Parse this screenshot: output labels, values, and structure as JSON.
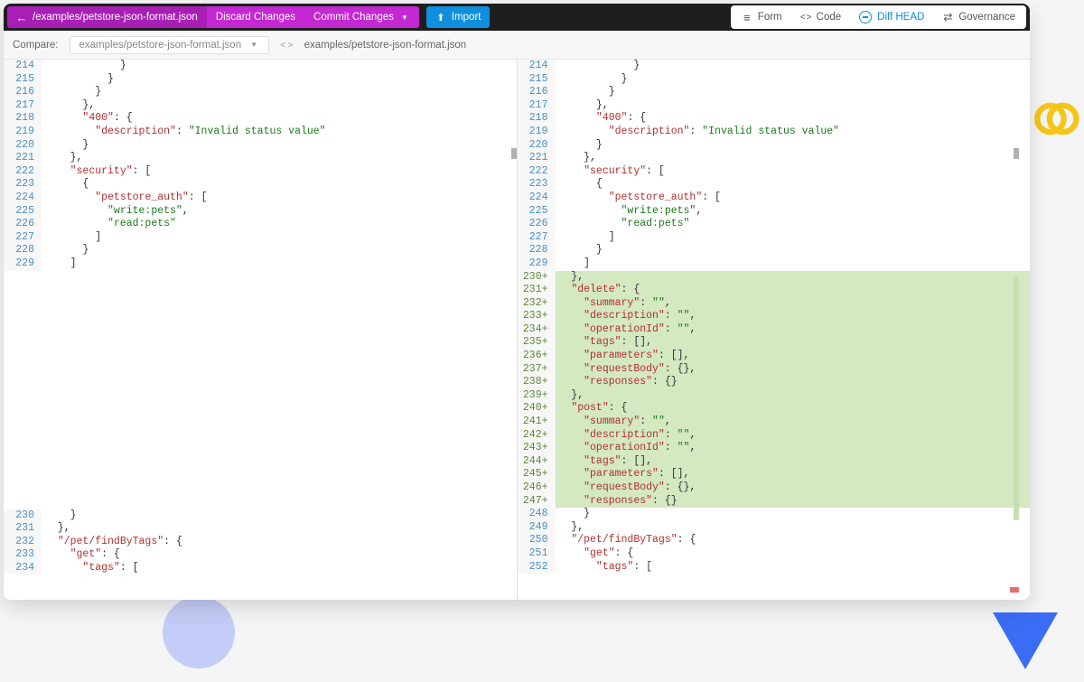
{
  "toolbar": {
    "path": "/examples/petstore-json-format.json",
    "discard": "Discard Changes",
    "commit": "Commit Changes",
    "import": "Import"
  },
  "views": {
    "form": "Form",
    "code": "Code",
    "diff": "Diff HEAD",
    "governance": "Governance"
  },
  "compare": {
    "label": "Compare:",
    "left_file": "examples/petstore-json-format.json",
    "right_file": "examples/petstore-json-format.json"
  },
  "left_lines": [
    {
      "n": "214",
      "code": [
        [
          "p",
          "            }"
        ]
      ]
    },
    {
      "n": "215",
      "code": [
        [
          "p",
          "          }"
        ]
      ]
    },
    {
      "n": "216",
      "code": [
        [
          "p",
          "        }"
        ]
      ]
    },
    {
      "n": "217",
      "code": [
        [
          "p",
          "      },"
        ]
      ]
    },
    {
      "n": "218",
      "code": [
        [
          "p",
          "      "
        ],
        [
          "k",
          "\"400\""
        ],
        [
          "p",
          ": {"
        ]
      ]
    },
    {
      "n": "219",
      "code": [
        [
          "p",
          "        "
        ],
        [
          "k",
          "\"description\""
        ],
        [
          "p",
          ": "
        ],
        [
          "s",
          "\"Invalid status value\""
        ]
      ]
    },
    {
      "n": "220",
      "code": [
        [
          "p",
          "      }"
        ]
      ]
    },
    {
      "n": "221",
      "code": [
        [
          "p",
          "    },"
        ]
      ]
    },
    {
      "n": "222",
      "code": [
        [
          "p",
          "    "
        ],
        [
          "k",
          "\"security\""
        ],
        [
          "p",
          ": ["
        ]
      ]
    },
    {
      "n": "223",
      "code": [
        [
          "p",
          "      {"
        ]
      ]
    },
    {
      "n": "224",
      "code": [
        [
          "p",
          "        "
        ],
        [
          "k",
          "\"petstore_auth\""
        ],
        [
          "p",
          ": ["
        ]
      ]
    },
    {
      "n": "225",
      "code": [
        [
          "p",
          "          "
        ],
        [
          "s",
          "\"write:pets\""
        ],
        [
          "p",
          ","
        ]
      ]
    },
    {
      "n": "226",
      "code": [
        [
          "p",
          "          "
        ],
        [
          "s",
          "\"read:pets\""
        ]
      ]
    },
    {
      "n": "227",
      "code": [
        [
          "p",
          "        ]"
        ]
      ]
    },
    {
      "n": "228",
      "code": [
        [
          "p",
          "      }"
        ]
      ]
    },
    {
      "n": "229",
      "code": [
        [
          "p",
          "    ]"
        ]
      ]
    }
  ],
  "left_bottom": [
    {
      "n": "230",
      "code": [
        [
          "p",
          "    }"
        ]
      ]
    },
    {
      "n": "231",
      "code": [
        [
          "p",
          "  },"
        ]
      ]
    },
    {
      "n": "232",
      "code": [
        [
          "p",
          "  "
        ],
        [
          "k",
          "\"/pet/findByTags\""
        ],
        [
          "p",
          ": {"
        ]
      ]
    },
    {
      "n": "233",
      "code": [
        [
          "p",
          "    "
        ],
        [
          "k",
          "\"get\""
        ],
        [
          "p",
          ": {"
        ]
      ]
    },
    {
      "n": "234",
      "code": [
        [
          "p",
          "      "
        ],
        [
          "k",
          "\"tags\""
        ],
        [
          "p",
          ": ["
        ]
      ]
    }
  ],
  "right_lines": [
    {
      "n": "214",
      "code": [
        [
          "p",
          "            }"
        ]
      ]
    },
    {
      "n": "215",
      "code": [
        [
          "p",
          "          }"
        ]
      ]
    },
    {
      "n": "216",
      "code": [
        [
          "p",
          "        }"
        ]
      ]
    },
    {
      "n": "217",
      "code": [
        [
          "p",
          "      },"
        ]
      ]
    },
    {
      "n": "218",
      "code": [
        [
          "p",
          "      "
        ],
        [
          "k",
          "\"400\""
        ],
        [
          "p",
          ": {"
        ]
      ]
    },
    {
      "n": "219",
      "code": [
        [
          "p",
          "        "
        ],
        [
          "k",
          "\"description\""
        ],
        [
          "p",
          ": "
        ],
        [
          "s",
          "\"Invalid status value\""
        ]
      ]
    },
    {
      "n": "220",
      "code": [
        [
          "p",
          "      }"
        ]
      ]
    },
    {
      "n": "221",
      "code": [
        [
          "p",
          "    },"
        ]
      ]
    },
    {
      "n": "222",
      "code": [
        [
          "p",
          "    "
        ],
        [
          "k",
          "\"security\""
        ],
        [
          "p",
          ": ["
        ]
      ]
    },
    {
      "n": "223",
      "code": [
        [
          "p",
          "      {"
        ]
      ]
    },
    {
      "n": "224",
      "code": [
        [
          "p",
          "        "
        ],
        [
          "k",
          "\"petstore_auth\""
        ],
        [
          "p",
          ": ["
        ]
      ]
    },
    {
      "n": "225",
      "code": [
        [
          "p",
          "          "
        ],
        [
          "s",
          "\"write:pets\""
        ],
        [
          "p",
          ","
        ]
      ]
    },
    {
      "n": "226",
      "code": [
        [
          "p",
          "          "
        ],
        [
          "s",
          "\"read:pets\""
        ]
      ]
    },
    {
      "n": "227",
      "code": [
        [
          "p",
          "        ]"
        ]
      ]
    },
    {
      "n": "228",
      "code": [
        [
          "p",
          "      }"
        ]
      ]
    },
    {
      "n": "229",
      "code": [
        [
          "p",
          "    ]"
        ]
      ]
    }
  ],
  "right_added": [
    {
      "n": "230+",
      "code": [
        [
          "p",
          "  },"
        ]
      ]
    },
    {
      "n": "231+",
      "code": [
        [
          "p",
          "  "
        ],
        [
          "k",
          "\"delete\""
        ],
        [
          "p",
          ": {"
        ]
      ]
    },
    {
      "n": "232+",
      "code": [
        [
          "p",
          "    "
        ],
        [
          "k",
          "\"summary\""
        ],
        [
          "p",
          ": "
        ],
        [
          "s",
          "\"\""
        ],
        [
          "p",
          ","
        ]
      ]
    },
    {
      "n": "233+",
      "code": [
        [
          "p",
          "    "
        ],
        [
          "k",
          "\"description\""
        ],
        [
          "p",
          ": "
        ],
        [
          "s",
          "\"\""
        ],
        [
          "p",
          ","
        ]
      ]
    },
    {
      "n": "234+",
      "code": [
        [
          "p",
          "    "
        ],
        [
          "k",
          "\"operationId\""
        ],
        [
          "p",
          ": "
        ],
        [
          "s",
          "\"\""
        ],
        [
          "p",
          ","
        ]
      ]
    },
    {
      "n": "235+",
      "code": [
        [
          "p",
          "    "
        ],
        [
          "k",
          "\"tags\""
        ],
        [
          "p",
          ": [],"
        ]
      ]
    },
    {
      "n": "236+",
      "code": [
        [
          "p",
          "    "
        ],
        [
          "k",
          "\"parameters\""
        ],
        [
          "p",
          ": [],"
        ]
      ]
    },
    {
      "n": "237+",
      "code": [
        [
          "p",
          "    "
        ],
        [
          "k",
          "\"requestBody\""
        ],
        [
          "p",
          ": {},"
        ]
      ]
    },
    {
      "n": "238+",
      "code": [
        [
          "p",
          "    "
        ],
        [
          "k",
          "\"responses\""
        ],
        [
          "p",
          ": {}"
        ]
      ]
    },
    {
      "n": "239+",
      "code": [
        [
          "p",
          "  },"
        ]
      ]
    },
    {
      "n": "240+",
      "code": [
        [
          "p",
          "  "
        ],
        [
          "k",
          "\"post\""
        ],
        [
          "p",
          ": {"
        ]
      ]
    },
    {
      "n": "241+",
      "code": [
        [
          "p",
          "    "
        ],
        [
          "k",
          "\"summary\""
        ],
        [
          "p",
          ": "
        ],
        [
          "s",
          "\"\""
        ],
        [
          "p",
          ","
        ]
      ]
    },
    {
      "n": "242+",
      "code": [
        [
          "p",
          "    "
        ],
        [
          "k",
          "\"description\""
        ],
        [
          "p",
          ": "
        ],
        [
          "s",
          "\"\""
        ],
        [
          "p",
          ","
        ]
      ]
    },
    {
      "n": "243+",
      "code": [
        [
          "p",
          "    "
        ],
        [
          "k",
          "\"operationId\""
        ],
        [
          "p",
          ": "
        ],
        [
          "s",
          "\"\""
        ],
        [
          "p",
          ","
        ]
      ]
    },
    {
      "n": "244+",
      "code": [
        [
          "p",
          "    "
        ],
        [
          "k",
          "\"tags\""
        ],
        [
          "p",
          ": [],"
        ]
      ]
    },
    {
      "n": "245+",
      "code": [
        [
          "p",
          "    "
        ],
        [
          "k",
          "\"parameters\""
        ],
        [
          "p",
          ": [],"
        ]
      ]
    },
    {
      "n": "246+",
      "code": [
        [
          "p",
          "    "
        ],
        [
          "k",
          "\"requestBody\""
        ],
        [
          "p",
          ": {},"
        ]
      ]
    },
    {
      "n": "247+",
      "code": [
        [
          "p",
          "    "
        ],
        [
          "k",
          "\"responses\""
        ],
        [
          "p",
          ": {}"
        ]
      ]
    }
  ],
  "right_bottom": [
    {
      "n": "248",
      "code": [
        [
          "p",
          "    }"
        ]
      ]
    },
    {
      "n": "249",
      "code": [
        [
          "p",
          "  },"
        ]
      ]
    },
    {
      "n": "250",
      "code": [
        [
          "p",
          "  "
        ],
        [
          "k",
          "\"/pet/findByTags\""
        ],
        [
          "p",
          ": {"
        ]
      ]
    },
    {
      "n": "251",
      "code": [
        [
          "p",
          "    "
        ],
        [
          "k",
          "\"get\""
        ],
        [
          "p",
          ": {"
        ]
      ]
    },
    {
      "n": "252",
      "code": [
        [
          "p",
          "      "
        ],
        [
          "k",
          "\"tags\""
        ],
        [
          "p",
          ": ["
        ]
      ]
    }
  ]
}
